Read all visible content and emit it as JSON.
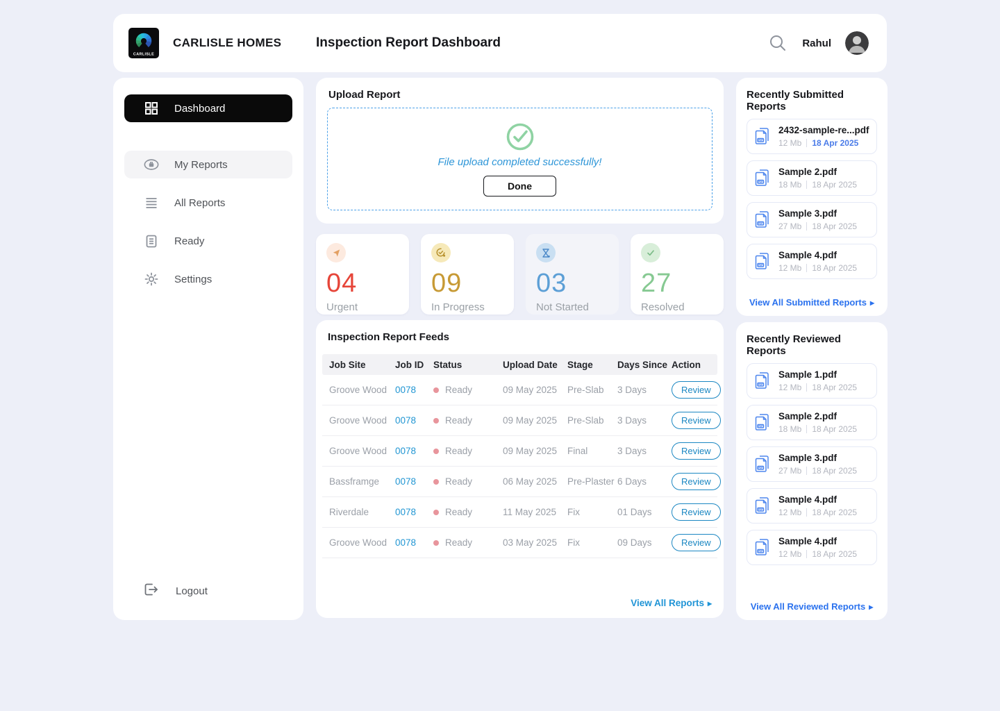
{
  "header": {
    "brand": "CARLISLE HOMES",
    "logo_text": "CARLISLE",
    "title": "Inspection Report Dashboard",
    "user_name": "Rahul"
  },
  "sidebar": {
    "items": [
      {
        "label": "Dashboard",
        "icon": "dashboard-grid-icon",
        "active": true
      },
      {
        "label": "My Reports",
        "icon": "briefcase-oval-icon",
        "highlighted": true
      },
      {
        "label": "All Reports",
        "icon": "list-lines-icon"
      },
      {
        "label": "Ready",
        "icon": "document-lines-icon"
      },
      {
        "label": "Settings",
        "icon": "gear-icon"
      }
    ],
    "logout_label": "Logout"
  },
  "upload": {
    "section_title": "Upload Report",
    "success_message": "File upload completed successfully!",
    "done_label": "Done"
  },
  "stats": [
    {
      "value": "04",
      "label": "Urgent",
      "number_color": "#e64539",
      "icon": "flag-pointer-icon",
      "icon_bg": "#fdeadf",
      "icon_color": "#e3a063"
    },
    {
      "value": "09",
      "label": "In Progress",
      "number_color": "#c79a35",
      "icon": "progress-check-icon",
      "icon_bg": "#f6e9b9",
      "icon_color": "#b8922f"
    },
    {
      "value": "03",
      "label": "Not Started",
      "number_color": "#5c9fd6",
      "icon": "hourglass-icon",
      "icon_bg": "#c9dff2",
      "icon_color": "#4a88c8"
    },
    {
      "value": "27",
      "label": "Resolved",
      "number_color": "#86c992",
      "icon": "check-icon",
      "icon_bg": "#d8eed9",
      "icon_color": "#7cbc88"
    }
  ],
  "feeds": {
    "section_title": "Inspection Report Feeds",
    "columns": [
      "Job Site",
      "Job ID",
      "Status",
      "Upload Date",
      "Stage",
      "Days Since",
      "Action"
    ],
    "rows": [
      {
        "job_site": "Groove Wood",
        "job_id": "0078",
        "status": "Ready",
        "upload_date": "09 May 2025",
        "stage": "Pre-Slab",
        "days_since": "3 Days",
        "action": "Review"
      },
      {
        "job_site": "Groove Wood",
        "job_id": "0078",
        "status": "Ready",
        "upload_date": "09 May 2025",
        "stage": "Pre-Slab",
        "days_since": "3 Days",
        "action": "Review"
      },
      {
        "job_site": "Groove Wood",
        "job_id": "0078",
        "status": "Ready",
        "upload_date": "09 May 2025",
        "stage": "Final",
        "days_since": "3 Days",
        "action": "Review"
      },
      {
        "job_site": "Bassframge",
        "job_id": "0078",
        "status": "Ready",
        "upload_date": "06 May 2025",
        "stage": "Pre-Plaster",
        "days_since": "6 Days",
        "action": "Review"
      },
      {
        "job_site": "Riverdale",
        "job_id": "0078",
        "status": "Ready",
        "upload_date": "11 May 2025",
        "stage": "Fix",
        "days_since": "01 Days",
        "action": "Review"
      },
      {
        "job_site": "Groove Wood",
        "job_id": "0078",
        "status": "Ready",
        "upload_date": "03 May 2025",
        "stage": "Fix",
        "days_since": "09 Days",
        "action": "Review"
      }
    ],
    "view_all": "View All Reports"
  },
  "submitted": {
    "title": "Recently Submitted Reports",
    "items": [
      {
        "name": "2432-sample-re...pdf",
        "size": "12 Mb",
        "date": "18 Apr 2025",
        "date_highlighted": true
      },
      {
        "name": "Sample 2.pdf",
        "size": "18 Mb",
        "date": "18 Apr 2025"
      },
      {
        "name": "Sample 3.pdf",
        "size": "27 Mb",
        "date": "18 Apr 2025"
      },
      {
        "name": "Sample 4.pdf",
        "size": "12 Mb",
        "date": "18 Apr 2025"
      }
    ],
    "view_all": "View All Submitted Reports"
  },
  "reviewed": {
    "title": "Recently Reviewed Reports",
    "items": [
      {
        "name": "Sample 1.pdf",
        "size": "12 Mb",
        "date": "18 Apr 2025"
      },
      {
        "name": "Sample 2.pdf",
        "size": "18 Mb",
        "date": "18 Apr 2025"
      },
      {
        "name": "Sample 3.pdf",
        "size": "27 Mb",
        "date": "18 Apr 2025"
      },
      {
        "name": "Sample 4.pdf",
        "size": "12 Mb",
        "date": "18 Apr 2025"
      },
      {
        "name": "Sample 4.pdf",
        "size": "12 Mb",
        "date": "18 Apr 2025"
      }
    ],
    "view_all": "View All Reviewed Reports"
  },
  "colors": {
    "page_bg": "#edeff8",
    "active_nav_bg": "#0a0a0a",
    "dashed_border_blue": "#4aa0e8",
    "success_green": "#8fd3a3",
    "success_text_blue": "#2e96d8",
    "job_id_link_blue": "#2196d3",
    "review_outline_blue": "#1b87c2",
    "table_link_blue": "#2094d6",
    "panel_link_blue": "#2b72ee",
    "date_highlight_blue": "#4b7ce8",
    "status_dot_pink": "#e8959c",
    "pdf_icon_blue": "#4d86ee"
  }
}
